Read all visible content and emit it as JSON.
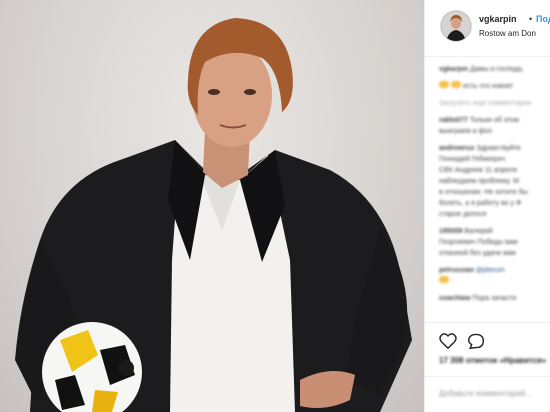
{
  "post": {
    "username": "vgkarpin",
    "separator": "•",
    "follow_label": "Подп",
    "location": "Rostow am Don"
  },
  "comments": [
    {
      "user": "vgkarpin",
      "text": "Дамы и господа,"
    },
    {
      "user": "",
      "text": "есть что новое!"
    },
    {
      "user": "",
      "text": "Загрузить еще комментарии"
    },
    {
      "user": "rablo077",
      "text": "Тольки об этом"
    },
    {
      "user": "",
      "text": "выиграем и фол"
    },
    {
      "user": "andrewrus",
      "text": "Здравствуйте"
    },
    {
      "user": "",
      "text": "Геннадий Гебикерич"
    },
    {
      "user": "",
      "text": "СВК Андреев 11 апреля"
    },
    {
      "user": "",
      "text": "наблюдаем проблему. М"
    },
    {
      "user": "",
      "text": "в отношение. Не хотите бы"
    },
    {
      "user": "",
      "text": "болеть, а я работу во у Ф"
    },
    {
      "user": "",
      "text": "старое делося"
    },
    {
      "user": "195009",
      "text": "Валерий"
    },
    {
      "user": "",
      "text": "Георгиевич Победы вам"
    },
    {
      "user": "",
      "text": "отказной без удачи вам"
    },
    {
      "user": "pelrussian",
      "text": "@pforum"
    },
    {
      "user": "",
      "text": ""
    },
    {
      "user": "coachlaw",
      "text": "Пора зачасти"
    }
  ],
  "actions": {
    "like_icon": "heart-icon",
    "comment_icon": "comment-icon"
  },
  "likes": "17 308 отметок «Нравится»",
  "add_comment_placeholder": "Добавьте комментарий..."
}
